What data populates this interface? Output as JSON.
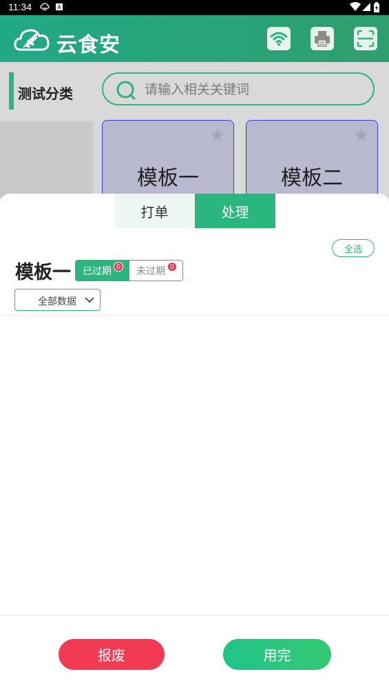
{
  "status_bar": {
    "time": "11:34"
  },
  "header": {
    "app_name": "云食安"
  },
  "category": {
    "title": "测试分类"
  },
  "search": {
    "placeholder": "请输入相关关键词"
  },
  "templates": [
    {
      "name": "模板一"
    },
    {
      "name": "模板二"
    }
  ],
  "sheet": {
    "tabs": [
      {
        "label": "打单",
        "active": false
      },
      {
        "label": "处理",
        "active": true
      }
    ],
    "select_all_label": "全选",
    "title": "模板一",
    "segments": [
      {
        "label": "已过期",
        "count": "0",
        "active": true
      },
      {
        "label": "未过期",
        "count": "0",
        "active": false
      }
    ],
    "filter": {
      "selected": "全部数据"
    },
    "buttons": {
      "scrap": "报废",
      "used": "用完"
    }
  },
  "colors": {
    "accent": "#2bb57f",
    "danger": "#f23a52",
    "card_border": "#2f3ee0"
  }
}
